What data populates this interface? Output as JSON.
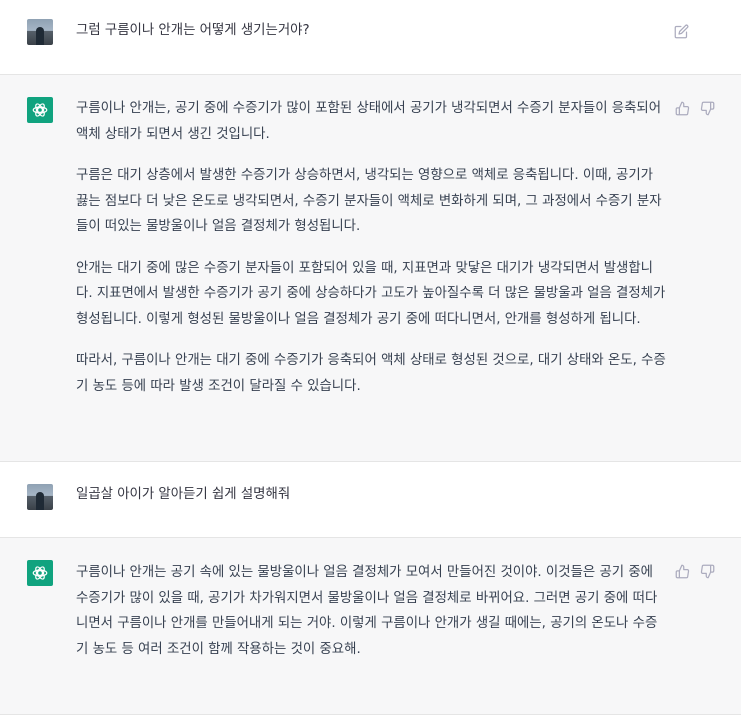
{
  "conversation": {
    "turns": [
      {
        "role": "user",
        "text": "그럼 구름이나 안개는 어떻게 생기는거야?"
      },
      {
        "role": "assistant",
        "paragraphs": [
          "구름이나 안개는, 공기 중에 수증기가 많이 포함된 상태에서 공기가 냉각되면서 수증기 분자들이 응축되어 액체 상태가 되면서 생긴 것입니다.",
          "구름은 대기 상층에서 발생한 수증기가 상승하면서, 냉각되는 영향으로 액체로 응축됩니다. 이때, 공기가 끓는 점보다 더 낮은 온도로 냉각되면서, 수증기 분자들이 액체로 변화하게 되며, 그 과정에서 수증기 분자들이 떠있는 물방울이나 얼음 결정체가 형성됩니다.",
          "안개는 대기 중에 많은 수증기 분자들이 포함되어 있을 때, 지표면과 맞닿은 대기가 냉각되면서 발생합니다. 지표면에서 발생한 수증기가 공기 중에 상승하다가 고도가 높아질수록 더 많은 물방울과 얼음 결정체가 형성됩니다. 이렇게 형성된 물방울이나 얼음 결정체가 공기 중에 떠다니면서, 안개를 형성하게 됩니다.",
          "따라서, 구름이나 안개는 대기 중에 수증기가 응축되어 액체 상태로 형성된 것으로, 대기 상태와 온도, 수증기 농도 등에 따라 발생 조건이 달라질 수 있습니다."
        ]
      },
      {
        "role": "user",
        "text": "일곱살 아이가 알아듣기 쉽게 설명해줘"
      },
      {
        "role": "assistant",
        "paragraphs": [
          "구름이나 안개는 공기 속에 있는 물방울이나 얼음 결정체가 모여서 만들어진 것이야. 이것들은 공기 중에 수증기가 많이 있을 때, 공기가 차가워지면서 물방울이나 얼음 결정체로 바뀌어요. 그러면 공기 중에 떠다니면서 구름이나 안개를 만들어내게 되는 거야. 이렇게 구름이나 안개가 생길 때에는, 공기의 온도나 수증기 농도 등 여러 조건이 함께 작용하는 것이 중요해."
        ]
      }
    ]
  },
  "icons": {
    "edit": "edit-icon",
    "thumbs_up": "thumbs-up-icon",
    "thumbs_down": "thumbs-down-icon",
    "assistant_logo": "openai-logo-icon",
    "user_avatar": "user-avatar-photo"
  },
  "colors": {
    "assistant_bg": "#f7f7f8",
    "user_bg": "#ffffff",
    "gpt_green": "#10a37f",
    "text": "#374151",
    "icon_gray": "#acacbe"
  }
}
